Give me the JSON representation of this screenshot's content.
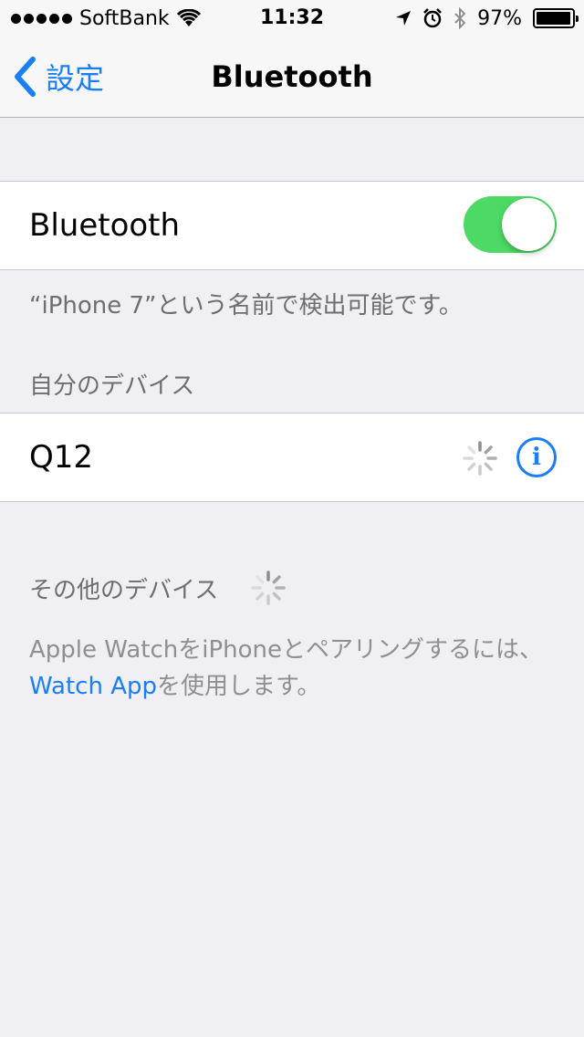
{
  "status_bar": {
    "carrier": "SoftBank",
    "time": "11:32",
    "battery_percent": "97%",
    "battery_level": 0.97,
    "icons": [
      "signal-dots",
      "wifi-icon",
      "location-arrow-icon",
      "alarm-icon",
      "bluetooth-icon",
      "battery-icon"
    ]
  },
  "navbar": {
    "back_label": "設定",
    "title": "Bluetooth"
  },
  "bluetooth_cell": {
    "label": "Bluetooth",
    "toggle_on": true,
    "toggle_color": "#4cd964"
  },
  "discoverable_text": "“iPhone 7”という名前で検出可能です。",
  "my_devices": {
    "header": "自分のデバイス",
    "items": [
      {
        "name": "Q12",
        "status": "connecting",
        "info_icon": "info-icon"
      }
    ]
  },
  "other_devices": {
    "header": "その他のデバイス"
  },
  "apple_watch_note": {
    "prefix": "Apple WatchをiPhoneとペアリングするには、",
    "link": "Watch App",
    "suffix": "を使用します。"
  },
  "colors": {
    "accent": "#1a7ff6",
    "background": "#efeff4",
    "secondary_text": "#6d6d72"
  }
}
